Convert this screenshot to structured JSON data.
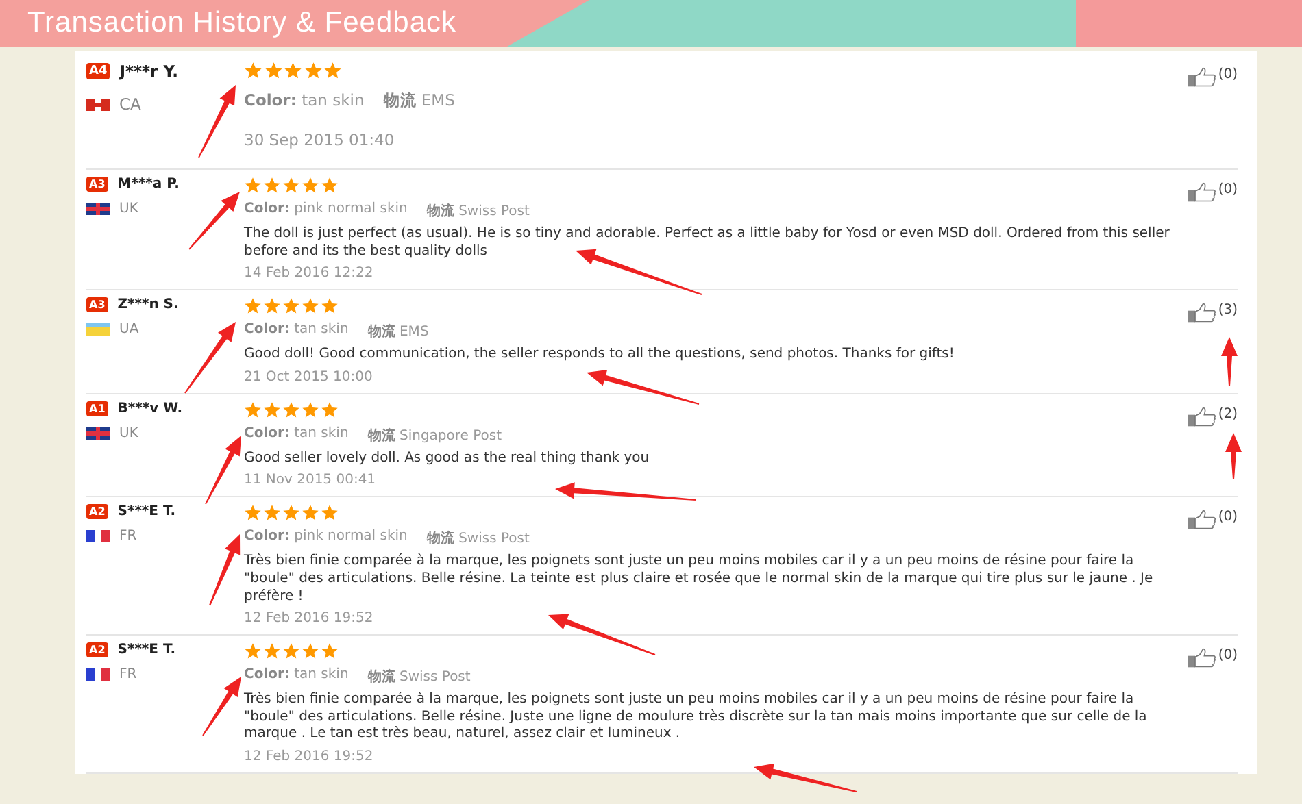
{
  "header": {
    "title": "Transaction History & Feedback"
  },
  "reviews": [
    {
      "kind": "featured",
      "badge": "A4",
      "user": "J***r Y.",
      "flag": {
        "kind": "ca"
      },
      "country": "CA",
      "stars": 5,
      "color_label": "Color:",
      "skin": "tan skin",
      "shipping_label": "物流",
      "shipping": "EMS",
      "date": "30 Sep 2015 01:40",
      "likes": "(0)"
    },
    {
      "kind": "regular",
      "badge": "A3",
      "user": "M***a P.",
      "flag": {
        "kind": "uk"
      },
      "country": "UK",
      "stars": 5,
      "color_label": "Color:",
      "skin": "pink normal skin",
      "shipping_label": "物流",
      "shipping": "Swiss Post",
      "text": "The doll is just perfect (as usual). He is so tiny and adorable. Perfect as a little baby for Yosd or even MSD doll. Ordered from this seller before and its the best quality dolls",
      "date": "14 Feb 2016 12:22",
      "likes": "(0)"
    },
    {
      "kind": "regular",
      "badge": "A3",
      "user": "Z***n S.",
      "flag": {
        "kind": "ua"
      },
      "country": "UA",
      "stars": 5,
      "color_label": "Color:",
      "skin": "tan skin",
      "shipping_label": "物流",
      "shipping": "EMS",
      "text": "Good doll! Good communication, the seller responds to all the questions, send photos. Thanks for gifts!",
      "date": "21 Oct 2015 10:00",
      "likes": "(3)"
    },
    {
      "kind": "regular",
      "badge": "A1",
      "user": "B***v W.",
      "flag": {
        "kind": "uk"
      },
      "country": "UK",
      "stars": 5,
      "color_label": "Color:",
      "skin": "tan skin",
      "shipping_label": "物流",
      "shipping": "Singapore Post",
      "text": "Good seller lovely doll. As good as the real thing thank you",
      "date": "11 Nov 2015 00:41",
      "likes": "(2)"
    },
    {
      "kind": "regular",
      "badge": "A2",
      "user": "S***E T.",
      "flag": {
        "kind": "fr"
      },
      "country": "FR",
      "stars": 5,
      "color_label": "Color:",
      "skin": "pink normal skin",
      "shipping_label": "物流",
      "shipping": "Swiss Post",
      "text": "Très bien finie comparée à la marque, les poignets sont juste un peu moins mobiles car il y a un peu moins de résine pour faire la \"boule\" des articulations. Belle résine. La teinte est plus claire et rosée que le normal skin de la marque qui tire plus sur le jaune . Je préfère !",
      "date": "12 Feb 2016 19:52",
      "likes": "(0)"
    },
    {
      "kind": "regular",
      "badge": "A2",
      "user": "S***E T.",
      "flag": {
        "kind": "fr"
      },
      "country": "FR",
      "stars": 5,
      "color_label": "Color:",
      "skin": "tan skin",
      "shipping_label": "物流",
      "shipping": "Swiss Post",
      "text": "Très bien finie comparée à la marque, les poignets sont juste un peu moins mobiles car il y a un peu moins de résine pour faire la \"boule\" des articulations. Belle résine. Juste une ligne de moulure très discrète sur la tan mais moins importante que sur celle de la marque . Le tan est très beau, naturel, assez clair et lumineux .",
      "date": "12 Feb 2016 19:52",
      "likes": "(0)"
    }
  ]
}
